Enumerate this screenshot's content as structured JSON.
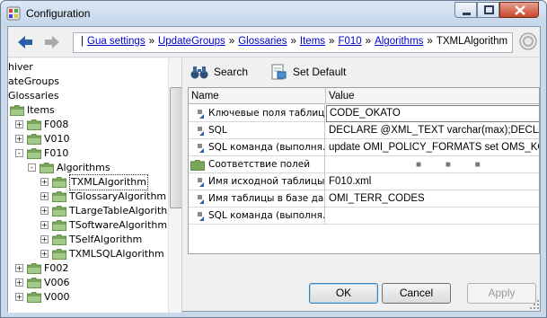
{
  "window": {
    "title": "Configuration"
  },
  "breadcrumb": [
    "Gua settings",
    "UpdateGroups",
    "Glossaries",
    "Items",
    "F010",
    "Algorithms"
  ],
  "breadcrumb_current": "TXMLAlgorithm",
  "tree": [
    {
      "label": "hiver",
      "level": 0,
      "expander": "",
      "folder": false
    },
    {
      "label": "ateGroups",
      "level": 0,
      "expander": "",
      "folder": false
    },
    {
      "label": "Glossaries",
      "level": 0,
      "expander": "",
      "folder": false
    },
    {
      "label": "Items",
      "level": 0,
      "expander": "",
      "folder": true
    },
    {
      "label": "F008",
      "level": 1,
      "expander": "+",
      "folder": true
    },
    {
      "label": "V010",
      "level": 1,
      "expander": "+",
      "folder": true
    },
    {
      "label": "F010",
      "level": 1,
      "expander": "-",
      "folder": true
    },
    {
      "label": "Algorithms",
      "level": 2,
      "expander": "-",
      "folder": true
    },
    {
      "label": "TXMLAlgorithm",
      "level": 3,
      "expander": "+",
      "folder": true,
      "selected": true
    },
    {
      "label": "TGlossaryAlgorithm",
      "level": 3,
      "expander": "+",
      "folder": true
    },
    {
      "label": "TLargeTableAlgorith",
      "level": 3,
      "expander": "+",
      "folder": true
    },
    {
      "label": "TSoftwareAlgorithm",
      "level": 3,
      "expander": "+",
      "folder": true
    },
    {
      "label": "TSelfAlgorithm",
      "level": 3,
      "expander": "+",
      "folder": true
    },
    {
      "label": "TXMLSQLAlgorithm",
      "level": 3,
      "expander": "+",
      "folder": true
    },
    {
      "label": "F002",
      "level": 1,
      "expander": "+",
      "folder": true
    },
    {
      "label": "V006",
      "level": 1,
      "expander": "+",
      "folder": true
    },
    {
      "label": "V000",
      "level": 1,
      "expander": "+",
      "folder": true
    }
  ],
  "toolbar": {
    "search_label": "Search",
    "set_default_label": "Set Default"
  },
  "grid": {
    "headers": {
      "name": "Name",
      "value": "Value"
    },
    "rows": [
      {
        "name": "Ключевые поля таблиц…",
        "value": "CODE_OKATO",
        "icon": "property-icon",
        "boxed": true
      },
      {
        "name": "SQL",
        "value": "DECLARE @XML_TEXT varchar(max);DECLAR…",
        "icon": "property-icon",
        "boxed": false
      },
      {
        "name": "SQL команда (выполня…",
        "value": "update OMI_POLICY_FORMATS set OMS_KO…",
        "icon": "property-icon",
        "boxed": false
      },
      {
        "name": "Соответствие полей",
        "value": "",
        "icon": "folder-icon",
        "boxed": false,
        "dots": "■ ■ ■"
      },
      {
        "name": "Имя исходной таблицы…",
        "value": "F010.xml",
        "icon": "property-icon",
        "boxed": false
      },
      {
        "name": "Имя таблицы в базе да…",
        "value": "OMI_TERR_CODES",
        "icon": "property-icon",
        "boxed": false
      },
      {
        "name": "SQL команда (выполня…",
        "value": "",
        "icon": "property-icon",
        "boxed": false
      }
    ]
  },
  "buttons": {
    "ok": "OK",
    "cancel": "Cancel",
    "apply": "Apply"
  },
  "colors": {
    "link": "#0000cc",
    "folder": "#7aa65a",
    "accent": "#3c7fb1"
  }
}
